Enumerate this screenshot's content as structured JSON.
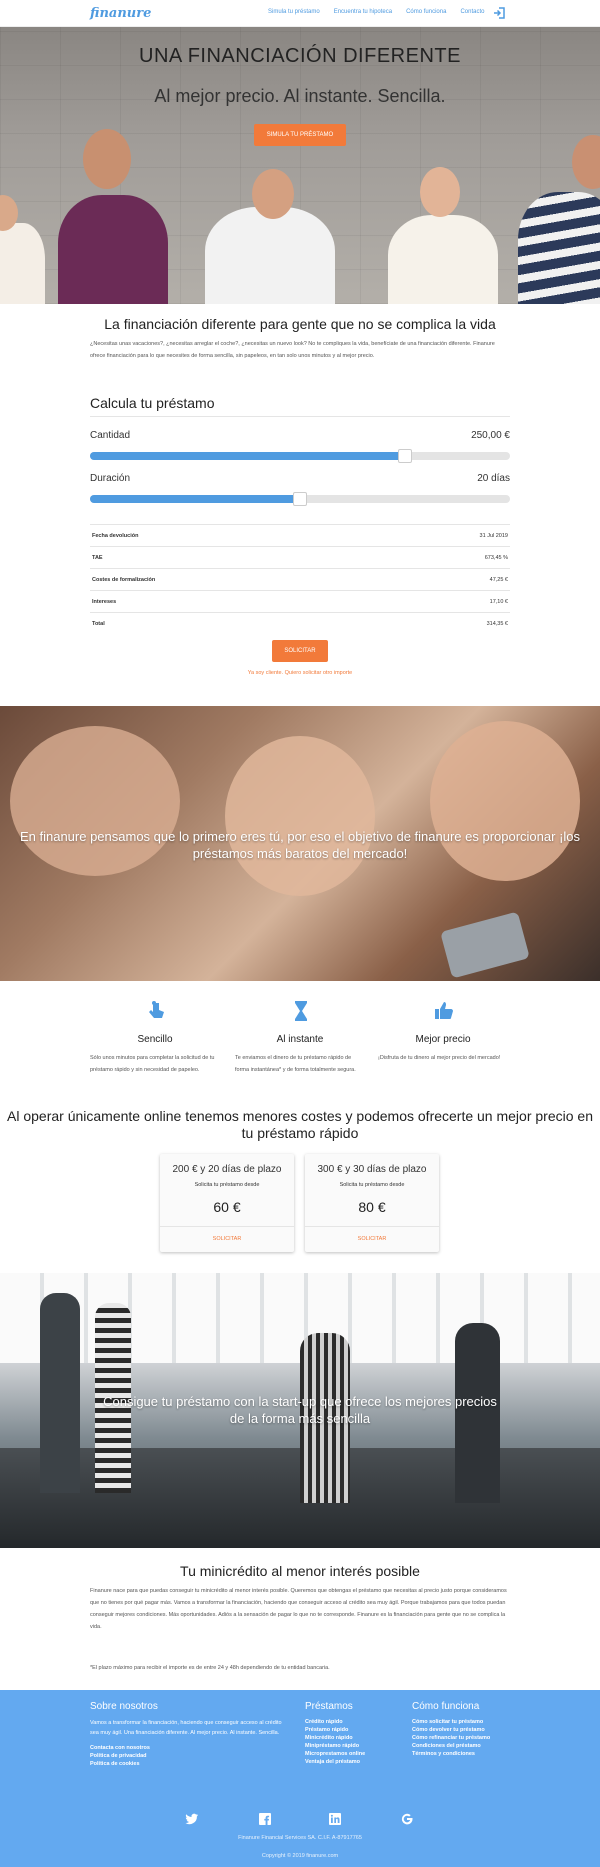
{
  "header": {
    "logo": "finanure",
    "nav": [
      "Simula tu préstamo",
      "Encuentra tu hipoteca",
      "Cómo funciona",
      "Contacto"
    ],
    "login_icon": "sign-in-icon"
  },
  "hero": {
    "title": "UNA FINANCIACIÓN DIFERENTE",
    "subtitle": "Al mejor precio. Al instante. Sencilla.",
    "button": "SIMULA TU PRÉSTAMO"
  },
  "intro": {
    "heading": "La financiación diferente para gente que no se complica la vida",
    "text": "¿Necesitas unas vacaciones?, ¿necesitas arreglar el coche?, ¿necesitas un nuevo look? No te compliques la vida, benefíciate de una financiación diferente. Finanure ofrece financiación para lo que necesites de forma sencilla, sin papeleos, en tan solo unos minutos y al mejor precio."
  },
  "calculator": {
    "title": "Calcula tu préstamo",
    "amount_label": "Cantidad",
    "amount_value": "250,00 €",
    "amount_fraction": 0.75,
    "duration_label": "Duración",
    "duration_value": "20 días",
    "duration_fraction": 0.5,
    "rows": [
      {
        "k": "Fecha devolución",
        "v": "31 Jul 2019"
      },
      {
        "k": "TAE",
        "v": "673,45 %"
      },
      {
        "k": "Costes de formalización",
        "v": "47,25 €"
      },
      {
        "k": "Intereses",
        "v": "17,10 €"
      },
      {
        "k": "Total",
        "v": "314,35 €"
      }
    ],
    "button": "SOLICITAR",
    "client_link": "Ya soy cliente. Quiero solicitar otro importe"
  },
  "banner1": {
    "text": "En finanure pensamos que lo primero eres tú, por eso el objetivo de finanure es proporcionar ¡los préstamos más baratos del mercado!"
  },
  "features": [
    {
      "icon": "touch-icon",
      "title": "Sencillo",
      "text": "Sólo unos minutos para completar la solicitud de tu préstamo rápido y sin necesidad de papeleo."
    },
    {
      "icon": "hourglass-icon",
      "title": "Al instante",
      "text": "Te enviamos el dinero de tu préstamo rápido de forma instantánea* y de forma totalmente segura."
    },
    {
      "icon": "thumbs-up-icon",
      "title": "Mejor precio",
      "text": "¡Disfruta de tu dinero al mejor precio del mercado!"
    }
  ],
  "offers": {
    "heading": "Al operar únicamente online tenemos menores costes y podemos ofrecerte un mejor precio en tu préstamo rápido",
    "cards": [
      {
        "title": "200 € y 20 días de plazo",
        "sub": "Solicita tu préstamo desde",
        "price": "60 €",
        "button": "SOLICITAR"
      },
      {
        "title": "300 € y 30 días de plazo",
        "sub": "Solicita tu préstamo desde",
        "price": "80 €",
        "button": "SOLICITAR"
      }
    ]
  },
  "banner2": {
    "text": "Consigue tu préstamo con la start-up que ofrece los mejores precios de la forma más sencilla"
  },
  "mini": {
    "heading": "Tu minicrédito al menor interés posible",
    "text": "Finanure nace para que puedas conseguir tu minicrédito al menor interés posible. Queremos que obtengas el préstamo que necesitas al precio justo porque consideramos que no tienes por qué pagar más. Vamos a transformar la financiación, haciendo que conseguir acceso al crédito sea muy ágil. Porque trabajamos para que todos puedan conseguir mejores condiciones. Más oportunidades. Adiós a la sensación de pagar lo que no te corresponde. Finanure es la financiación para gente que no se complica la vida.",
    "note": "*El plazo máximo para recibir el importe es de entre 24 y 48h dependiendo de tu entidad bancaria."
  },
  "footer": {
    "about_title": "Sobre nosotros",
    "about_text": "Vamos a transformar la financiación, haciendo que conseguir acceso al crédito sea muy ágil. Una financiación diferente. Al mejor precio. Al instante. Sencilla.",
    "about_links": [
      "Contacta con nosotros",
      "Política de privacidad",
      "Política de cookies"
    ],
    "loans_title": "Préstamos",
    "loans_links": [
      "Crédito rápido",
      "Préstamo rápido",
      "Minicrédito rápido",
      "Minipréstamo rápido",
      "Microprestamos online",
      "Ventaja del préstamo"
    ],
    "how_title": "Cómo funciona",
    "how_links": [
      "Cómo solicitar tu préstamo",
      "Cómo devolver tu préstamo",
      "Cómo refinanciar tu préstamo",
      "Condiciones del préstamo",
      "Términos y condiciones"
    ],
    "social": [
      "twitter-icon",
      "facebook-icon",
      "linkedin-icon",
      "google-icon"
    ],
    "company": "Finanure Financial Services SA. C.I.F. A-87917765",
    "copyright": "Copyright © 2019 finanure.com"
  },
  "colors": {
    "primary": "#4f9be0",
    "accent": "#f27a3a",
    "footer": "#63a9f0"
  }
}
